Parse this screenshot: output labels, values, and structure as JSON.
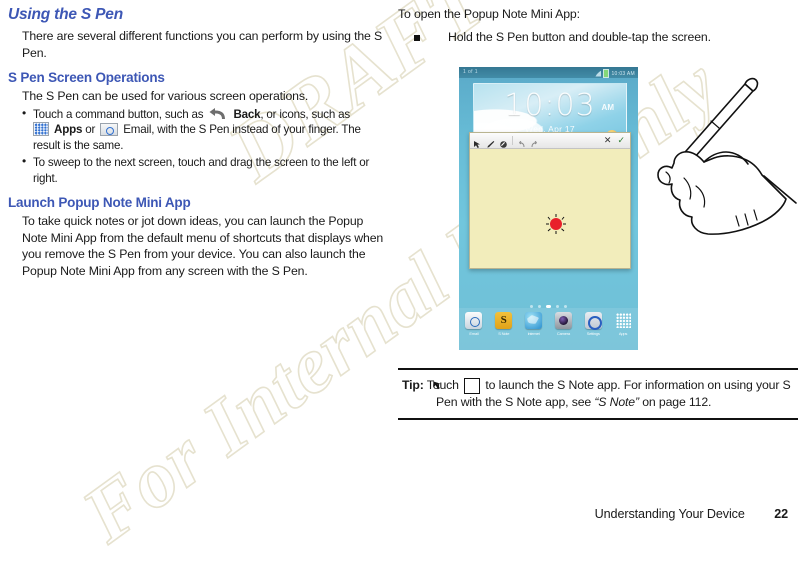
{
  "left_column": {
    "chapter_heading": "Using the S Pen",
    "intro": "There are several different functions you can perform by using the S Pen.",
    "section_heading": "S Pen Screen Operations",
    "section_intro": "The S Pen can be used for various screen operations.",
    "bullets": [
      {
        "part1": "Touch a command button, such as",
        "icon1": "back-icon",
        "label1": "Back",
        "part2": ", or icons, such as",
        "icon2": "apps-icon",
        "label2": "Apps",
        "part3": "or",
        "icon3": "email-icon",
        "label3": "Email",
        "part4": ", with the S Pen instead of your finger. The result is the same."
      },
      {
        "text": "To sweep to the next screen, touch and drag the screen to the left or right."
      }
    ],
    "section_heading2": "Launch Popup Note Mini App",
    "section2_body": "To take quick notes or jot down ideas, you can launch the Popup Note Mini App from the default menu of shortcuts that displays when you remove the S Pen from your device. You can also launch the Popup Note Mini App from any screen with the S Pen."
  },
  "right_column": {
    "intro": "To open the Popup Note Mini App:",
    "steps": [
      "Hold the S Pen button and double-tap the screen."
    ],
    "tip": {
      "label": "Tip:",
      "before_icon": "Touch",
      "icon": "s-note-icon",
      "after_icon": "to launch the S Note app. For information on using your S Pen with the S Note app, see",
      "reference": "“S Note”",
      "tail": "on page 112."
    }
  },
  "figure": {
    "tablet": {
      "status_bar": {
        "left_text": "1 of 1",
        "time": "10:03 AM"
      },
      "clock_widget": {
        "time": "10:03",
        "ampm": "AM",
        "date": "Wed, Apr 17"
      },
      "popup_note": {
        "toolbar_icons": [
          "select-arrow-icon",
          "pen-icon",
          "eraser-icon",
          "undo-icon",
          "redo-icon"
        ],
        "close_glyph": "✕",
        "save_glyph": "✓"
      },
      "dock": [
        {
          "name": "email-app-icon",
          "label": "Email"
        },
        {
          "name": "s-note-app-icon",
          "label": "S Note"
        },
        {
          "name": "internet-app-icon",
          "label": "Internet"
        },
        {
          "name": "camera-app-icon",
          "label": "Camera"
        },
        {
          "name": "settings-app-icon",
          "label": "Settings"
        },
        {
          "name": "apps-drawer-icon",
          "label": "Apps"
        }
      ],
      "page_dot_count": 5,
      "active_page_dot": 3
    },
    "hand_illustration": "hand-holding-s-pen",
    "tap_indicator": "red-tap-burst"
  },
  "watermark": {
    "line1": "DRAFT",
    "line2": "For Internal Use Only"
  },
  "footer": {
    "title": "Understanding Your Device",
    "page": "22"
  },
  "colors": {
    "heading_blue": "#3d57b5",
    "tap_red": "#e8202a",
    "note_yellow": "#f2edbb",
    "watermark": "#e6e2cf"
  }
}
